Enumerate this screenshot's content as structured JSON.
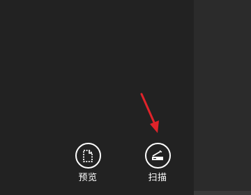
{
  "actions": [
    {
      "label": "预览",
      "icon": "document-preview-icon"
    },
    {
      "label": "扫描",
      "icon": "scanner-icon"
    }
  ],
  "annotation": {
    "color": "#e0232a"
  }
}
